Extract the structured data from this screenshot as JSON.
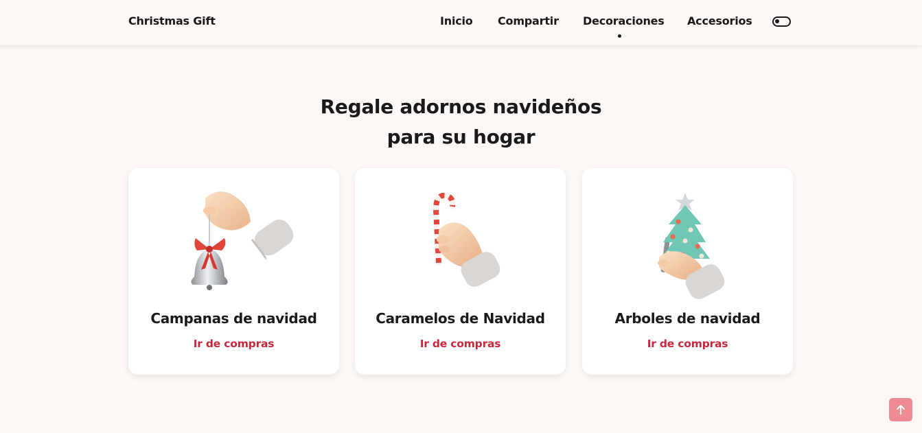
{
  "header": {
    "logo": "Christmas Gift",
    "nav": [
      {
        "label": "Inicio"
      },
      {
        "label": "Compartir"
      },
      {
        "label": "Decoraciones",
        "active": true
      },
      {
        "label": "Accesorios"
      }
    ],
    "theme_toggle_icon": "toggle-switch-icon"
  },
  "main": {
    "title_line1": "Regale adornos navideños",
    "title_line2": "para su hogar",
    "cards": [
      {
        "title": "Campanas de navidad",
        "link": "Ir de compras",
        "image": "hand-holding-bell"
      },
      {
        "title": "Caramelos de Navidad",
        "link": "Ir de compras",
        "image": "hand-holding-candy-cane"
      },
      {
        "title": "Arboles de navidad",
        "link": "Ir de compras",
        "image": "hand-holding-christmas-tree"
      }
    ]
  },
  "scroll_up_icon": "arrow-up-icon",
  "colors": {
    "background": "#fdf7f6",
    "accent": "#c7273d",
    "scroll_button": "#ee8a92",
    "text": "#1a1a1a"
  }
}
